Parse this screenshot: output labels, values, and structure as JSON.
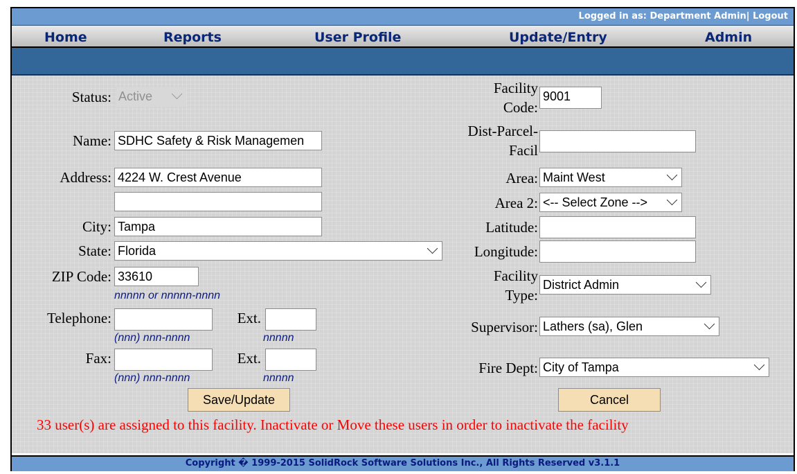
{
  "header": {
    "login_text": "Logged in as: Department Admin|",
    "logout_label": "Logout"
  },
  "nav": {
    "items": [
      "Home",
      "Reports",
      "User Profile",
      "Update/Entry",
      "Admin"
    ]
  },
  "form": {
    "status": {
      "label": "Status:",
      "value": "Active"
    },
    "name": {
      "label": "Name:",
      "value": "SDHC Safety & Risk Managemen"
    },
    "address": {
      "label": "Address:",
      "value": "4224 W. Crest Avenue",
      "value2": ""
    },
    "city": {
      "label": "City:",
      "value": "Tampa"
    },
    "state": {
      "label": "State:",
      "value": "Florida"
    },
    "zip": {
      "label": "ZIP Code:",
      "value": "33610",
      "hint": "nnnnn or nnnnn-nnnn"
    },
    "telephone": {
      "label": "Telephone:",
      "value": "",
      "hint": "(nnn) nnn-nnnn",
      "ext_label": "Ext.",
      "ext_value": "",
      "ext_hint": "nnnnn"
    },
    "fax": {
      "label": "Fax:",
      "value": "",
      "hint": "(nnn) nnn-nnnn",
      "ext_label": "Ext.",
      "ext_value": "",
      "ext_hint": "nnnnn"
    },
    "facility_code": {
      "label_line1": "Facility",
      "label_line2": "Code:",
      "value": "9001"
    },
    "dist_parcel": {
      "label_line1": "Dist-Parcel-",
      "label_line2": "Facil",
      "value": ""
    },
    "area": {
      "label": "Area:",
      "value": "Maint West"
    },
    "area2": {
      "label": "Area 2:",
      "value": "<-- Select Zone -->"
    },
    "latitude": {
      "label": "Latitude:",
      "value": ""
    },
    "longitude": {
      "label": "Longitude:",
      "value": ""
    },
    "facility_type": {
      "label_line1": "Facility",
      "label_line2": "Type:",
      "value": "District Admin"
    },
    "supervisor": {
      "label": "Supervisor:",
      "value": "Lathers (sa), Glen"
    },
    "fire_dept": {
      "label": "Fire Dept:",
      "value": "City of Tampa"
    }
  },
  "buttons": {
    "save": "Save/Update",
    "cancel": "Cancel"
  },
  "warning": "33 user(s) are assigned to this facility. Inactivate or Move these users in order to inactivate the facility",
  "footer": "Copyright � 1999-2015 SolidRock Software Solutions Inc., All Rights Reserved v3.1.1",
  "colors": {
    "topbar": "#6b9bd1",
    "bluebar": "#336699",
    "nav_text": "#0a2677",
    "button": "#f5deb3",
    "warning": "#ff0000",
    "hint": "#0a1a80"
  }
}
